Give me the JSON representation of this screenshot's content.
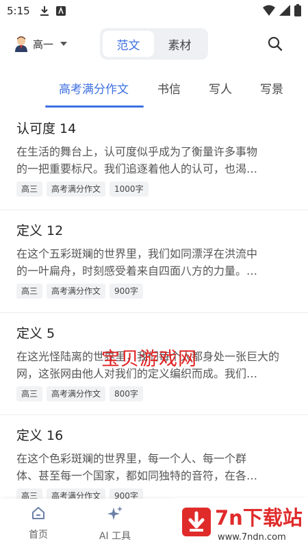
{
  "status_bar": {
    "time": "5:15"
  },
  "header": {
    "grade": "高一",
    "segments": [
      "范文",
      "素材"
    ],
    "active_segment": 0
  },
  "tabs": [
    "高考满分作文",
    "书信",
    "写人",
    "写景"
  ],
  "articles": [
    {
      "title": "认可度 14",
      "summary_lines": [
        "在生活的舞台上，认可度似乎成为了衡量许多事物",
        "的一把重要标尺。我们追逐着他人的认可，也渴…"
      ],
      "tags": [
        "高三",
        "高考满分作文",
        "1000字"
      ]
    },
    {
      "title": "定义 12",
      "summary_lines": [
        "在这个五彩斑斓的世界里，我们如同漂浮在洪流中",
        "的一叶扁舟，时刻感受着来自四面八方的力量。…"
      ],
      "tags": [
        "高三",
        "高考满分作文",
        "900字"
      ]
    },
    {
      "title": "定义 5",
      "summary_lines": [
        "在这光怪陆离的世界里，我们每个人都身处一张巨大的",
        "网，这张网由他人对我们的定义编织而成。我们…"
      ],
      "tags": [
        "高三",
        "高考满分作文",
        "800字"
      ]
    },
    {
      "title": "定义 16",
      "summary_lines": [
        "在这个色彩斑斓的世界里，每一个人、每一个群",
        "体、甚至每一个国家，都如同独特的音符，在各…"
      ],
      "tags": [
        "高三",
        "高考满分作文",
        "900字"
      ]
    }
  ],
  "watermark": "宝贝游戏网",
  "bottom_nav": [
    {
      "label": "首页",
      "icon": "home-icon"
    },
    {
      "label": "AI 工具",
      "icon": "sparkle-icon"
    }
  ],
  "promo": {
    "title": "7n下载站",
    "url": "www.7ndn.com"
  },
  "colors": {
    "accent": "#3d6fe0",
    "promo_red": "#e02b2b"
  }
}
